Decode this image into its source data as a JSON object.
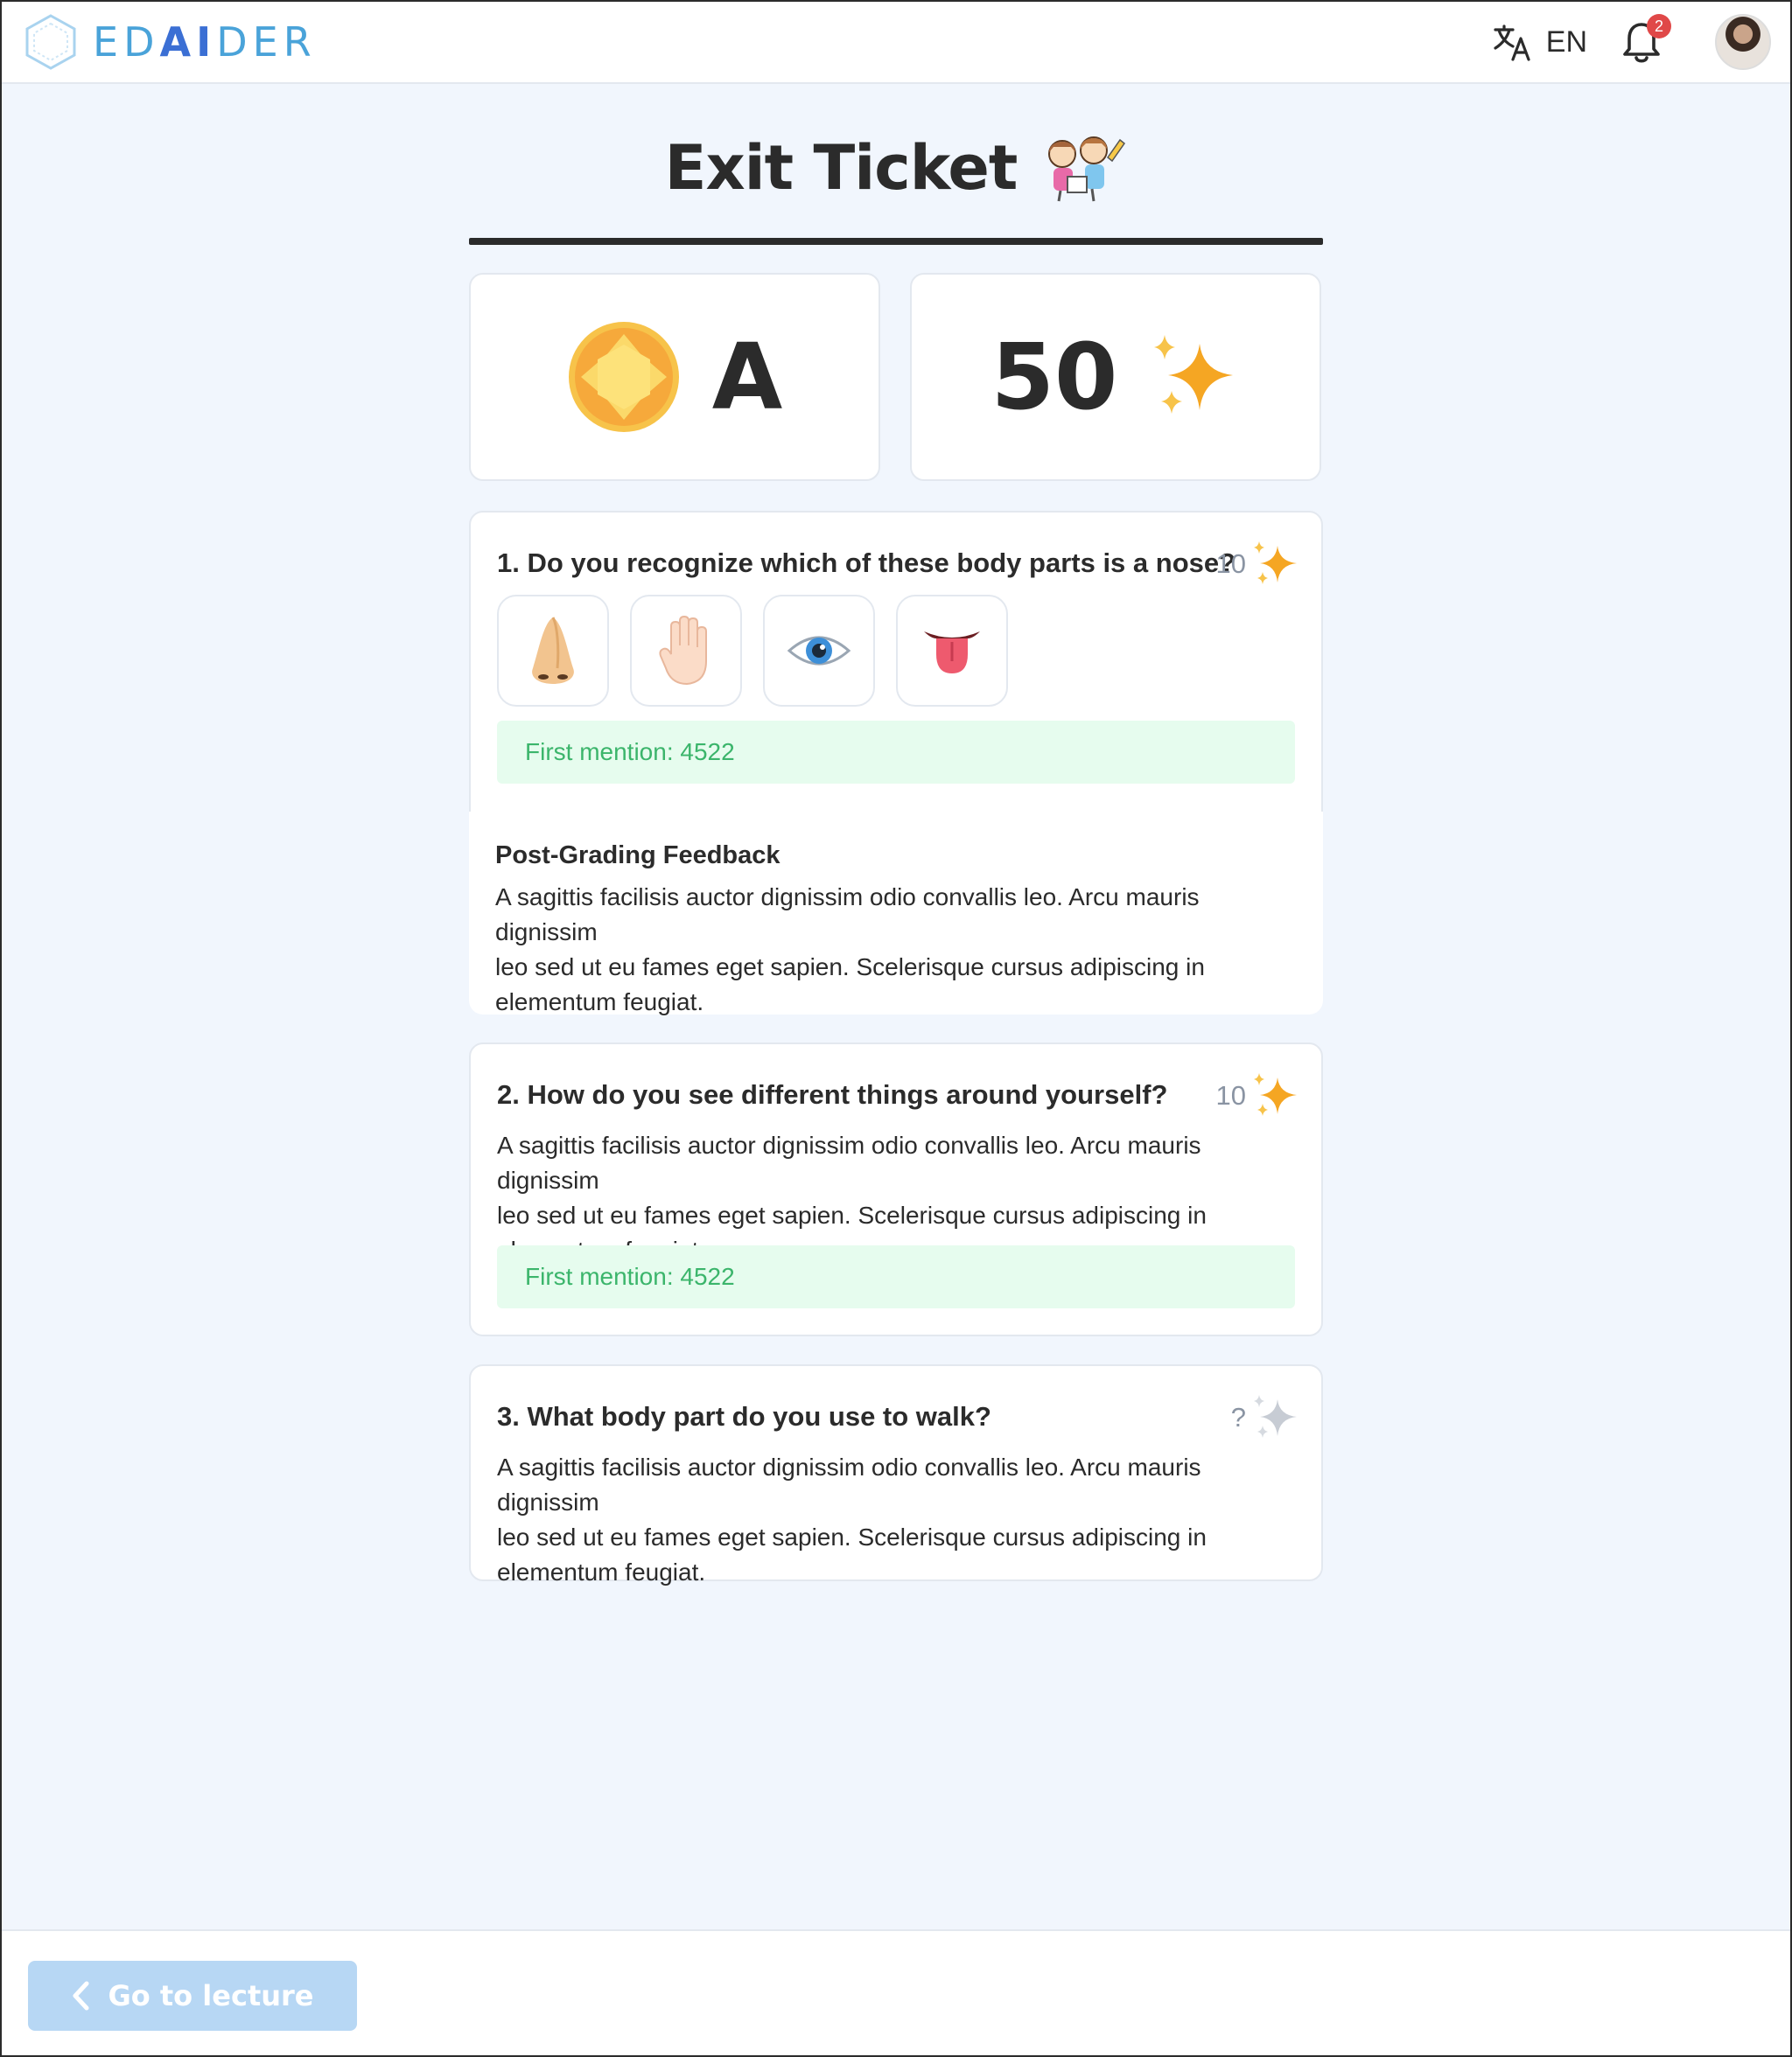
{
  "header": {
    "logo_prefix": "ED",
    "logo_mid": "AI",
    "logo_suffix": "DER",
    "language": "EN",
    "notification_count": "2"
  },
  "page": {
    "title": "Exit Ticket"
  },
  "scores": {
    "grade": "A",
    "points": "50"
  },
  "questions": [
    {
      "title": "1. Do you recognize which of these body parts is a nose?",
      "points": "10",
      "options": [
        "nose-icon",
        "hand-icon",
        "eye-icon",
        "tongue-icon"
      ],
      "mention": "First mention: 4522",
      "feedback_title": "Post-Grading Feedback",
      "feedback_lines": [
        "A sagittis facilisis auctor dignissim odio convallis leo. Arcu mauris dignissim",
        "leo sed ut eu fames eget sapien. Scelerisque cursus adipiscing in",
        "elementum feugiat."
      ]
    },
    {
      "title": "2. How do you see different things around yourself?",
      "points": "10",
      "answer_lines": [
        "A sagittis facilisis auctor dignissim odio convallis leo. Arcu mauris dignissim",
        "leo sed ut eu fames eget sapien. Scelerisque cursus adipiscing in",
        "elementum feugiat."
      ],
      "mention": "First mention: 4522"
    },
    {
      "title": "3. What body part do you use to walk?",
      "points": "?",
      "answer_lines": [
        "A sagittis facilisis auctor dignissim odio convallis leo. Arcu mauris dignissim",
        "leo sed ut eu fames eget sapien. Scelerisque cursus adipiscing in",
        "elementum feugiat."
      ]
    }
  ],
  "footer": {
    "back_label": "Go to lecture"
  },
  "colors": {
    "sparkle_active": "#f5a623",
    "sparkle_inactive": "#c7ccd4",
    "mention_bg": "#e6fcee",
    "mention_text": "#3bb56b",
    "button_disabled": "#b7d7f4"
  }
}
